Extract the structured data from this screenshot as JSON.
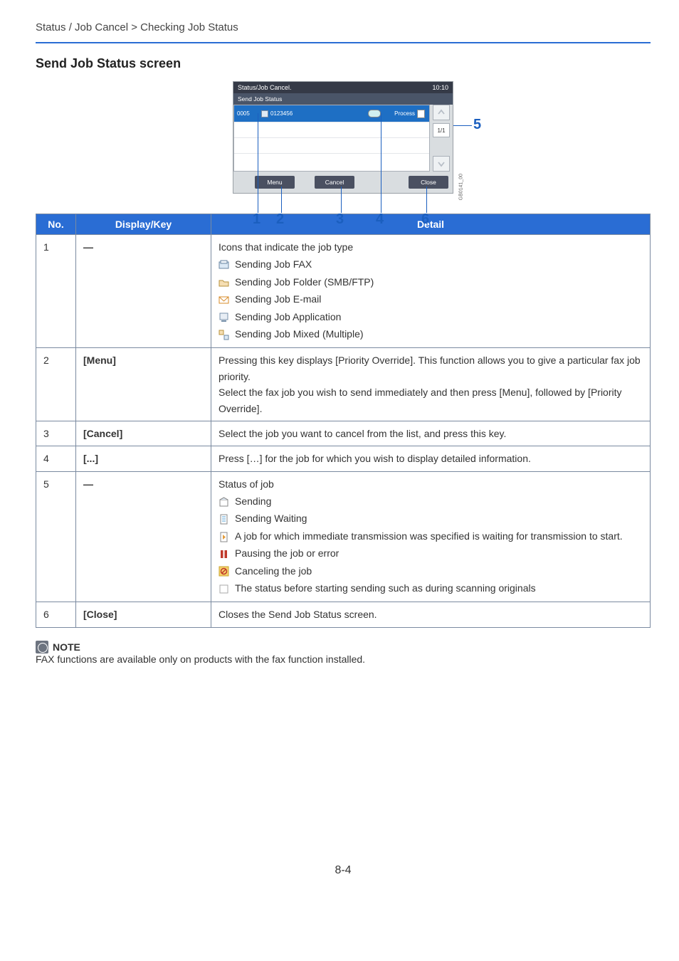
{
  "breadcrumb": "Status / Job Cancel > Checking Job Status",
  "section_title": "Send Job Status screen",
  "panel": {
    "title": "Status/Job Cancel.",
    "time": "10:10",
    "subtitle": "Send Job Status",
    "row": {
      "id": "0005",
      "name": "0123456",
      "status": "Process"
    },
    "page_ind": "1/1",
    "btn_menu": "Menu",
    "btn_cancel": "Cancel",
    "btn_close": "Close",
    "side_code": "GB0141_00"
  },
  "callouts": {
    "n1": "1",
    "n2": "2",
    "n3": "3",
    "n4": "4",
    "n5": "5",
    "n6": "6"
  },
  "table": {
    "head": {
      "no": "No.",
      "display": "Display/Key",
      "detail": "Detail"
    },
    "rows": [
      {
        "no": "1",
        "key": "―",
        "detail_lead": "Icons that indicate the job type",
        "items": [
          "Sending Job FAX",
          "Sending Job Folder (SMB/FTP)",
          "Sending Job E-mail",
          "Sending Job Application",
          "Sending Job Mixed (Multiple)"
        ]
      },
      {
        "no": "2",
        "key": "[Menu]",
        "detail_p1": "Pressing this key displays [Priority Override]. This function allows you to give a particular fax job priority.",
        "detail_p2": "Select the fax job you wish to send immediately and then press [Menu], followed by [Priority Override]."
      },
      {
        "no": "3",
        "key": "[Cancel]",
        "detail": "Select the job you want to cancel from the list, and press this key."
      },
      {
        "no": "4",
        "key": "[...]",
        "detail": "Press […] for the job for which you wish to display detailed information."
      },
      {
        "no": "5",
        "key": "―",
        "detail_lead": "Status of job",
        "items": [
          "Sending",
          "Sending Waiting",
          "A job for which immediate transmission was specified is waiting for transmission to start.",
          "Pausing the job or error",
          "Canceling the job",
          "The status before starting sending such as during scanning originals"
        ]
      },
      {
        "no": "6",
        "key": "[Close]",
        "detail": "Closes the Send Job Status screen."
      }
    ]
  },
  "note": {
    "label": "NOTE",
    "text": "FAX functions are available only on products with the fax function installed."
  },
  "page_number": "8-4"
}
